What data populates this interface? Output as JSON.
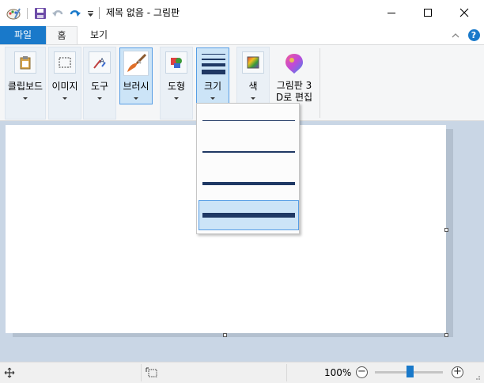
{
  "window": {
    "title": "제목 없음 - 그림판",
    "controls": {
      "minimize": "—",
      "maximize": "☐",
      "close": "✕"
    }
  },
  "quick_access": {
    "icons": [
      "paint-app-icon",
      "save-icon",
      "undo-icon",
      "redo-icon",
      "customize-dropdown-icon"
    ]
  },
  "tabs": {
    "file": "파일",
    "home": "홈",
    "view": "보기",
    "active": "home"
  },
  "ribbon": {
    "groups": [
      {
        "id": "clipboard",
        "label": "클립보드",
        "icon": "clipboard-icon",
        "has_caret": true,
        "selected": false
      },
      {
        "id": "image",
        "label": "이미지",
        "icon": "select-icon",
        "has_caret": true,
        "selected": false
      },
      {
        "id": "tools",
        "label": "도구",
        "icon": "tools-icon",
        "has_caret": true,
        "selected": false
      },
      {
        "id": "brushes",
        "label": "브러시",
        "icon": "brush-icon",
        "has_caret": true,
        "selected": true
      },
      {
        "id": "shapes",
        "label": "도형",
        "icon": "shapes-icon",
        "has_caret": true,
        "selected": false
      },
      {
        "id": "size",
        "label": "크기",
        "icon": "size-lines-icon",
        "has_caret": true,
        "selected": true
      },
      {
        "id": "colors",
        "label": "색",
        "icon": "color-palette-icon",
        "has_caret": true,
        "selected": false
      },
      {
        "id": "paint3d",
        "label": "그림판 3 D로 편집",
        "label_line1": "그림판 3",
        "label_line2": "D로 편집",
        "icon": "paint-3d-icon",
        "has_caret": false,
        "selected": false
      }
    ]
  },
  "size_menu": {
    "options": [
      {
        "level": 1,
        "selected": false
      },
      {
        "level": 2,
        "selected": false
      },
      {
        "level": 3,
        "selected": false
      },
      {
        "level": 4,
        "selected": true
      }
    ]
  },
  "statusbar": {
    "icons": [
      "cursor-position-icon",
      "selection-size-icon"
    ],
    "zoom_label": "100%",
    "zoom_minus": "−",
    "zoom_plus": "+",
    "zoom_fraction": 0.5
  },
  "colors": {
    "accent": "#1979ca",
    "selection_bg": "#cce4f7",
    "selection_border": "#569de5",
    "workspace_bg": "#c9d6e5",
    "line_color": "#1f3864"
  }
}
